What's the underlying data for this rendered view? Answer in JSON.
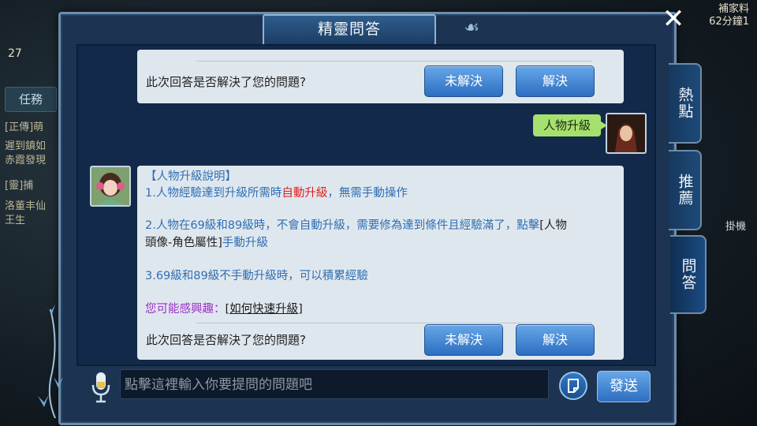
{
  "background": {
    "left_num": "27",
    "left_task_tab": "任務",
    "left_lines": [
      "[正傳]萌",
      "遲到鎮如",
      "赤霞發現",
      "[靈]捕",
      "洛董丰仙",
      "王生"
    ],
    "right_top": [
      "補家料",
      "62分鐘1"
    ],
    "right_guaji": "掛機"
  },
  "dialog": {
    "title": "精靈問答",
    "close_symbol": "✕"
  },
  "tabs": [
    {
      "label": "熱點",
      "active": false
    },
    {
      "label": "推薦",
      "active": false
    },
    {
      "label": "問答",
      "active": true
    }
  ],
  "top_card": {
    "question": "此次回答是否解決了您的問題?",
    "unresolved_label": "未解決",
    "resolved_label": "解決"
  },
  "user_message": "人物升級",
  "answer": {
    "title": "【人物升級說明】",
    "line1_prefix": "1.人物經驗達到升級所需時",
    "line1_highlight": "自動升級",
    "line1_suffix": "，無需手動操作",
    "line2_part1": "2.人物在69級和89級時，不會自動升級，需要修為達到條件且經驗滿了，點擊",
    "line2_bracket": "[人物",
    "line2_part2": "頭像-角色屬性]",
    "line2_suffix": "手動升級",
    "line3": "3.69級和89級不手動升級時，可以積累經驗",
    "interest_label": "您可能感興趣：",
    "interest_link": "如何快速升級",
    "question": "此次回答是否解決了您的問題?",
    "unresolved_label": "未解決",
    "resolved_label": "解決"
  },
  "input": {
    "placeholder": "點擊這裡輸入你要提問的問題吧"
  },
  "send_label": "發送",
  "colors": {
    "panel": "#1c3351",
    "chat_bg": "#13294a",
    "card": "#dfe7ee",
    "button_blue": "#2c6ec2",
    "user_bubble": "#a6e16f",
    "highlight_red": "#e11d1d",
    "text_blue": "#2f6fb3",
    "text_purple": "#9b2fc9"
  }
}
